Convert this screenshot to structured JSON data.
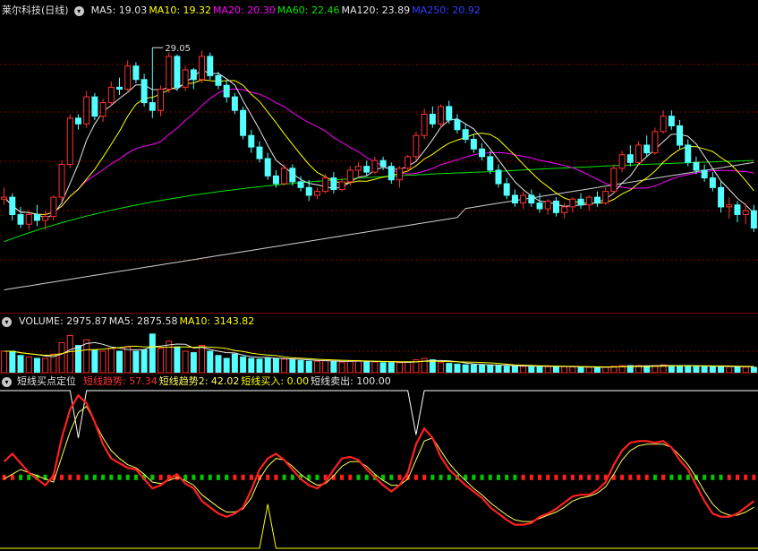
{
  "colors": {
    "up": "#ff3232",
    "down": "#54ffff",
    "ma5": "#e6e6e6",
    "ma10": "#ffff00",
    "ma20": "#ff00ff",
    "ma60": "#00e400",
    "ma120": "#d0d0d0",
    "ma250": "#3a3aff",
    "grid": "#8a0000",
    "trend1": "#ff2020",
    "trend2": "#ffff60",
    "buy": "#ffff00",
    "sell": "#ffffff"
  },
  "price_panel": {
    "title": "莱尔科技(日线)",
    "icon": "chevron-down-icon",
    "indicators": [
      {
        "label": "MA5:",
        "value": "19.03",
        "color": "#e6e6e6"
      },
      {
        "label": "MA10:",
        "value": "19.32",
        "color": "#ffff00"
      },
      {
        "label": "MA20:",
        "value": "20.30",
        "color": "#ff00ff"
      },
      {
        "label": "MA60:",
        "value": "22.46",
        "color": "#00e400"
      },
      {
        "label": "MA120:",
        "value": "23.89",
        "color": "#e6e6e6"
      },
      {
        "label": "MA250:",
        "value": "20.92",
        "color": "#3a3aff"
      }
    ],
    "high_label": "29.05"
  },
  "volume_panel": {
    "icon": "chevron-down-icon",
    "indicators": [
      {
        "label": "VOLUME:",
        "value": "2975.87",
        "color": "#e6e6e6"
      },
      {
        "label": "MA5:",
        "value": "2875.58",
        "color": "#e6e6e6"
      },
      {
        "label": "MA10:",
        "value": "3143.82",
        "color": "#ffff00"
      }
    ]
  },
  "signal_panel": {
    "title": "短线买点定位",
    "icon": "chevron-down-icon",
    "indicators": [
      {
        "label": "短线趋势:",
        "value": "57.34",
        "color": "#ff3232"
      },
      {
        "label": "短线趋势2:",
        "value": "42.02",
        "color": "#ffff60"
      },
      {
        "label": "短线买入:",
        "value": "0.00",
        "color": "#ffff00"
      },
      {
        "label": "短线卖出:",
        "value": "100.00",
        "color": "#e6e6e6"
      }
    ]
  },
  "chart_data": {
    "type": "candlestick",
    "price_range": [
      15.5,
      30.5
    ],
    "ohlc": [
      [
        21.2,
        21.8,
        20.9,
        21.3
      ],
      [
        21.3,
        21.5,
        20.1,
        20.4
      ],
      [
        20.4,
        20.8,
        19.7,
        19.9
      ],
      [
        19.9,
        20.6,
        19.6,
        20.4
      ],
      [
        20.4,
        20.9,
        19.8,
        20.1
      ],
      [
        20.1,
        20.6,
        19.6,
        20.3
      ],
      [
        20.3,
        21.4,
        20.1,
        21.3
      ],
      [
        21.3,
        23.2,
        21.1,
        23.0
      ],
      [
        23.0,
        25.6,
        22.8,
        25.4
      ],
      [
        25.4,
        25.6,
        24.8,
        25.1
      ],
      [
        25.1,
        26.8,
        24.9,
        26.5
      ],
      [
        26.5,
        26.7,
        25.3,
        25.5
      ],
      [
        25.5,
        26.4,
        25.2,
        26.2
      ],
      [
        26.2,
        27.3,
        26.0,
        27.0
      ],
      [
        27.0,
        27.5,
        26.6,
        26.9
      ],
      [
        26.9,
        28.4,
        26.8,
        28.1
      ],
      [
        28.1,
        28.3,
        27.2,
        27.4
      ],
      [
        27.4,
        27.7,
        26.0,
        26.2
      ],
      [
        26.2,
        29.05,
        25.4,
        25.8
      ],
      [
        25.8,
        27.1,
        25.5,
        26.9
      ],
      [
        26.9,
        28.8,
        26.7,
        28.6
      ],
      [
        28.6,
        28.7,
        26.8,
        27.0
      ],
      [
        27.0,
        28.1,
        26.8,
        27.9
      ],
      [
        27.9,
        28.0,
        26.9,
        27.4
      ],
      [
        27.4,
        28.9,
        27.2,
        28.6
      ],
      [
        28.6,
        28.8,
        27.4,
        27.6
      ],
      [
        27.6,
        27.8,
        26.9,
        27.1
      ],
      [
        27.1,
        27.4,
        26.2,
        26.5
      ],
      [
        26.5,
        26.7,
        25.6,
        25.8
      ],
      [
        25.8,
        26.0,
        24.3,
        24.5
      ],
      [
        24.5,
        24.8,
        23.6,
        23.9
      ],
      [
        23.9,
        24.2,
        23.1,
        23.3
      ],
      [
        23.3,
        23.6,
        22.2,
        22.4
      ],
      [
        22.4,
        22.7,
        21.8,
        22.0
      ],
      [
        22.0,
        23.0,
        21.9,
        22.8
      ],
      [
        22.8,
        23.0,
        21.9,
        22.1
      ],
      [
        22.1,
        22.4,
        21.6,
        21.8
      ],
      [
        21.8,
        22.2,
        21.1,
        21.4
      ],
      [
        21.4,
        21.8,
        21.2,
        21.6
      ],
      [
        21.6,
        22.5,
        21.5,
        22.3
      ],
      [
        22.3,
        22.6,
        21.5,
        21.7
      ],
      [
        21.7,
        22.3,
        21.6,
        22.1
      ],
      [
        22.1,
        22.9,
        21.9,
        22.7
      ],
      [
        22.7,
        23.1,
        22.3,
        22.9
      ],
      [
        22.9,
        23.2,
        22.4,
        22.6
      ],
      [
        22.6,
        23.4,
        22.5,
        23.2
      ],
      [
        23.2,
        23.4,
        22.7,
        22.9
      ],
      [
        22.9,
        23.1,
        22.0,
        22.2
      ],
      [
        22.2,
        22.9,
        21.8,
        22.8
      ],
      [
        22.8,
        23.5,
        22.6,
        23.4
      ],
      [
        23.4,
        24.7,
        23.2,
        24.5
      ],
      [
        24.5,
        25.9,
        24.3,
        25.6
      ],
      [
        25.6,
        26.0,
        24.9,
        25.1
      ],
      [
        25.1,
        26.1,
        24.9,
        26.0
      ],
      [
        26.0,
        26.3,
        25.1,
        25.3
      ],
      [
        25.3,
        25.6,
        24.6,
        24.8
      ],
      [
        24.8,
        25.1,
        24.1,
        24.3
      ],
      [
        24.3,
        24.6,
        23.6,
        23.8
      ],
      [
        23.8,
        24.1,
        23.2,
        23.4
      ],
      [
        23.4,
        23.7,
        22.5,
        22.7
      ],
      [
        22.7,
        23.0,
        21.8,
        22.0
      ],
      [
        22.0,
        22.3,
        21.2,
        21.4
      ],
      [
        21.4,
        21.7,
        20.8,
        21.0
      ],
      [
        21.0,
        21.6,
        20.7,
        21.4
      ],
      [
        21.4,
        21.7,
        20.8,
        21.0
      ],
      [
        21.0,
        21.5,
        20.5,
        20.7
      ],
      [
        20.7,
        21.2,
        20.4,
        21.1
      ],
      [
        21.1,
        21.3,
        20.3,
        20.5
      ],
      [
        20.5,
        21.0,
        20.2,
        20.8
      ],
      [
        20.8,
        21.3,
        20.5,
        21.2
      ],
      [
        21.2,
        21.5,
        20.7,
        20.9
      ],
      [
        20.9,
        21.4,
        20.6,
        21.3
      ],
      [
        21.3,
        21.6,
        20.8,
        21.0
      ],
      [
        21.0,
        21.8,
        20.9,
        21.6
      ],
      [
        21.6,
        23.0,
        21.5,
        22.8
      ],
      [
        22.8,
        23.7,
        22.6,
        23.5
      ],
      [
        23.5,
        24.0,
        22.9,
        23.1
      ],
      [
        23.1,
        24.2,
        23.0,
        24.0
      ],
      [
        24.0,
        24.5,
        23.4,
        23.6
      ],
      [
        23.6,
        24.9,
        23.5,
        24.7
      ],
      [
        24.7,
        25.8,
        24.6,
        25.5
      ],
      [
        25.5,
        25.8,
        24.8,
        25.0
      ],
      [
        25.0,
        25.3,
        23.8,
        24.0
      ],
      [
        24.0,
        24.3,
        22.9,
        23.1
      ],
      [
        23.1,
        23.4,
        22.5,
        22.7
      ],
      [
        22.7,
        23.0,
        22.1,
        22.3
      ],
      [
        22.3,
        22.6,
        21.6,
        21.8
      ],
      [
        21.8,
        22.1,
        20.5,
        20.8
      ],
      [
        20.8,
        21.3,
        20.2,
        20.9
      ],
      [
        20.9,
        21.1,
        20.0,
        20.4
      ],
      [
        20.4,
        21.0,
        19.9,
        20.6
      ],
      [
        20.6,
        20.9,
        19.5,
        19.7
      ]
    ],
    "volume_range": [
      0,
      3000
    ],
    "volume": [
      1500,
      1500,
      1200,
      1100,
      1000,
      1000,
      1300,
      2100,
      2600,
      1900,
      2300,
      1600,
      1500,
      1700,
      1500,
      1800,
      1500,
      1600,
      2700,
      1700,
      2200,
      1800,
      1500,
      1400,
      1900,
      1500,
      1200,
      1000,
      1300,
      1100,
      1000,
      950,
      1000,
      1000,
      950,
      900,
      850,
      800,
      800,
      850,
      800,
      750,
      800,
      850,
      800,
      750,
      700,
      700,
      700,
      750,
      900,
      1000,
      900,
      700,
      650,
      600,
      550,
      550,
      550,
      500,
      500,
      450,
      450,
      450,
      450,
      450,
      420,
      420,
      420,
      400,
      380,
      380,
      380,
      380,
      450,
      500,
      500,
      500,
      450,
      500,
      550,
      500,
      480,
      470,
      450,
      440,
      430,
      450,
      420,
      400,
      390,
      380
    ],
    "signal_range": [
      0,
      100
    ],
    "trend1": [
      55,
      60,
      54,
      48,
      44,
      40,
      46,
      70,
      88,
      97,
      92,
      80,
      66,
      57,
      54,
      51,
      50,
      44,
      38,
      40,
      44,
      47,
      41,
      38,
      30,
      26,
      22,
      20,
      22,
      26,
      37,
      50,
      57,
      60,
      56,
      50,
      44,
      40,
      38,
      42,
      50,
      57,
      58,
      56,
      50,
      45,
      40,
      36,
      40,
      48,
      66,
      76,
      70,
      58,
      50,
      45,
      40,
      36,
      32,
      26,
      22,
      18,
      15,
      15,
      16,
      20,
      22,
      25,
      29,
      33,
      34,
      34,
      37,
      42,
      53,
      62,
      67,
      68,
      68,
      67,
      68,
      64,
      56,
      50,
      40,
      30,
      22,
      20,
      20,
      22,
      26,
      30
    ],
    "trend2": [
      44,
      47,
      50,
      48,
      46,
      44,
      42,
      58,
      74,
      86,
      90,
      80,
      70,
      62,
      57,
      53,
      51,
      47,
      42,
      41,
      43,
      45,
      43,
      40,
      34,
      30,
      26,
      23,
      23,
      25,
      32,
      44,
      52,
      57,
      56,
      52,
      47,
      43,
      40,
      41,
      46,
      52,
      55,
      55,
      52,
      47,
      43,
      40,
      40,
      44,
      56,
      68,
      70,
      62,
      54,
      48,
      43,
      38,
      34,
      29,
      25,
      21,
      18,
      17,
      17,
      19,
      21,
      23,
      26,
      30,
      32,
      33,
      35,
      39,
      47,
      56,
      62,
      65,
      66,
      66,
      66,
      64,
      59,
      53,
      45,
      36,
      28,
      23,
      21,
      21,
      23,
      26
    ],
    "buy": [
      0,
      0,
      0,
      0,
      0,
      0,
      0,
      0,
      0,
      0,
      0,
      0,
      0,
      0,
      0,
      0,
      0,
      0,
      0,
      0,
      0,
      0,
      0,
      0,
      0,
      0,
      0,
      0,
      0,
      0,
      0,
      0,
      0,
      0,
      0,
      0,
      0,
      0,
      0,
      0,
      0,
      0,
      0,
      0,
      0,
      0,
      0,
      0,
      0,
      0,
      0,
      0,
      0,
      0,
      0,
      0,
      0,
      0,
      0,
      0,
      0,
      0,
      0,
      0,
      0,
      0,
      0,
      0,
      0,
      0,
      0,
      0,
      0,
      0,
      0,
      0,
      0,
      0,
      0,
      0,
      0,
      0,
      0,
      0,
      0,
      0,
      0,
      0,
      0,
      0,
      0,
      0
    ],
    "sell": [
      100,
      100,
      100,
      100,
      100,
      100,
      100,
      100,
      100,
      100,
      100,
      100,
      100,
      100,
      100,
      100,
      100,
      100,
      100,
      100,
      100,
      100,
      100,
      100,
      100,
      100,
      100,
      100,
      100,
      100,
      100,
      100,
      100,
      100,
      100,
      100,
      100,
      100,
      100,
      100,
      100,
      100,
      100,
      100,
      100,
      100,
      100,
      100,
      100,
      100,
      100,
      100,
      100,
      100,
      100,
      100,
      100,
      100,
      100,
      100,
      100,
      100,
      100,
      100,
      100,
      100,
      100,
      100,
      100,
      100,
      100,
      100,
      100,
      100,
      100,
      100,
      100,
      100,
      100,
      100,
      100,
      100,
      100,
      100,
      100,
      100,
      100,
      100,
      100,
      100,
      100,
      100
    ],
    "signal_events": [
      {
        "series": "sell",
        "index": 9,
        "value": 70
      },
      {
        "series": "sell",
        "index": 50,
        "value": 72
      },
      {
        "series": "buy",
        "index": 32,
        "value": 28
      }
    ]
  }
}
